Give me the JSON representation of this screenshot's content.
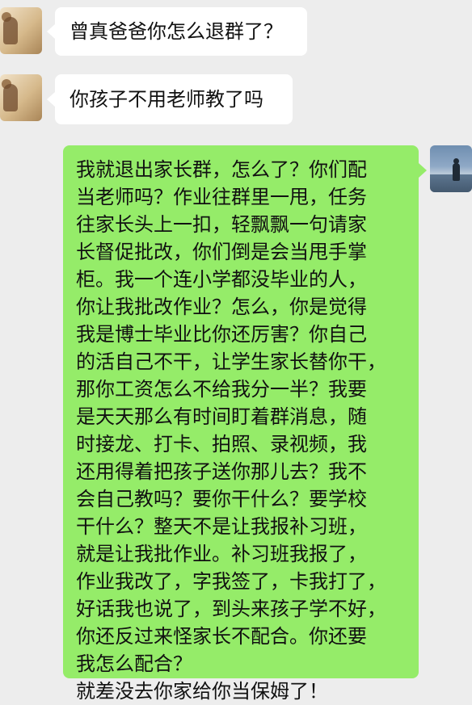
{
  "chat": {
    "messages": [
      {
        "side": "left",
        "text": "曾真爸爸你怎么退群了？"
      },
      {
        "side": "left",
        "text": "你孩子不用老师教了吗"
      },
      {
        "side": "right",
        "text": "我就退出家长群，怎么了？你们配\n当老师吗？作业往群里一甩，任务\n往家长头上一扣，轻飘飘一句请家\n长督促批改，你们倒是会当甩手掌\n柜。我一个连小学都没毕业的人，\n你让我批改作业？怎么，你是觉得\n我是博士毕业比你还厉害？你自己\n的活自己不干，让学生家长替你干，\n那你工资怎么不给我分一半？我要\n是天天那么有时间盯着群消息，随\n时接龙、打卡、拍照、录视频，我\n还用得着把孩子送你那儿去？我不\n会自己教吗？要你干什么？要学校\n干什么？整天不是让我报补习班，\n就是让我批作业。补习班我报了，\n作业我改了，字我签了，卡我打了，\n好话我也说了，到头来孩子学不好，\n你还反过来怪家长不配合。你还要\n我怎么配合？\n就差没去你家给你当保姆了！"
      }
    ]
  },
  "colors": {
    "background": "#ededed",
    "incoming_bubble": "#ffffff",
    "outgoing_bubble": "#95ec69"
  }
}
